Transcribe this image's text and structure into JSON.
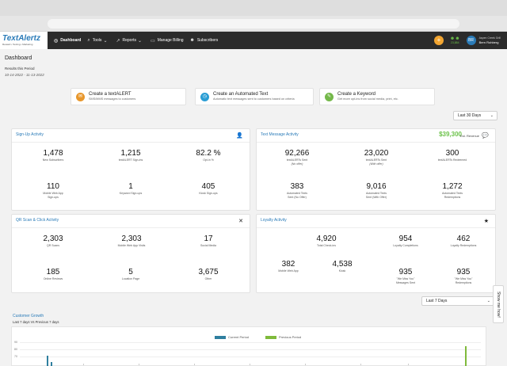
{
  "nav": {
    "logo_text": "TextAlertz",
    "logo_sub": "Reward • Texting • Marketing",
    "items": [
      {
        "label": "Dashboard",
        "icon": "dashboard-icon"
      },
      {
        "label": "Tools",
        "icon": "search-icon"
      },
      {
        "label": "Reports",
        "icon": "chart-icon"
      },
      {
        "label": "Manage Billing",
        "icon": "billing-icon"
      },
      {
        "label": "Subscribers",
        "icon": "subscribers-icon"
      }
    ],
    "plus": "+",
    "subscriber_count": "23,884",
    "avatar": "BR",
    "account_location": "Aspen Creek Grill",
    "account_name": "Bern Rohberg"
  },
  "page": {
    "title": "Dashboard",
    "results_label": "Results this Period",
    "date_range": "10-14-2022 - 11-13-2022"
  },
  "quick_actions": [
    {
      "title": "Create a textALERT",
      "desc": "SMS/MMS messages to customers",
      "color": "#e8972c"
    },
    {
      "title": "Create an Automated Text",
      "desc": "Automatic text messages sent to customers based on criteria",
      "color": "#2a9dd4"
    },
    {
      "title": "Create a Keyword",
      "desc": "Get more opt-ins from social media, print, etc.",
      "color": "#74b84a"
    }
  ],
  "period_select": "Last 30 Days",
  "signup": {
    "title": "Sign-Up Activity",
    "stats": [
      {
        "value": "1,478",
        "label": "New Subscribers",
        "label2": ""
      },
      {
        "value": "1,215",
        "label": "textALERT Sign-ins",
        "label2": ""
      },
      {
        "value": "82.2 %",
        "label": "Opt-in %",
        "label2": ""
      },
      {
        "value": "110",
        "label": "Mobile Web App",
        "label2": "Sign-ups"
      },
      {
        "value": "1",
        "label": "Keyword Sign-ups",
        "label2": ""
      },
      {
        "value": "405",
        "label": "Kiosk Sign-ups",
        "label2": ""
      }
    ]
  },
  "text_message": {
    "title": "Text Message Activity",
    "revenue": "$39,300",
    "revenue_label": "Est. Revenue",
    "stats": [
      {
        "value": "92,266",
        "label": "textALERTs Sent",
        "label2": "(No offer)"
      },
      {
        "value": "23,020",
        "label": "textALERTs Sent",
        "label2": "(With offer)"
      },
      {
        "value": "300",
        "label": "textALERTs Redeemed",
        "label2": ""
      },
      {
        "value": "383",
        "label": "Automated Texts",
        "label2": "Sent (No Offer)"
      },
      {
        "value": "9,016",
        "label": "Automated Texts",
        "label2": "Sent (With Offer)"
      },
      {
        "value": "1,272",
        "label": "Automated Texts",
        "label2": "Redemptions"
      }
    ]
  },
  "qr": {
    "title": "QR Scan & Click Activity",
    "stats": [
      {
        "value": "2,303",
        "label": "QR Scans",
        "label2": ""
      },
      {
        "value": "2,303",
        "label": "Mobile Web App Visits",
        "label2": ""
      },
      {
        "value": "17",
        "label": "Social Media",
        "label2": ""
      },
      {
        "value": "185",
        "label": "Online Reviews",
        "label2": ""
      },
      {
        "value": "5",
        "label": "Location Page",
        "label2": ""
      },
      {
        "value": "3,675",
        "label": "Other",
        "label2": ""
      }
    ]
  },
  "loyalty": {
    "title": "Loyalty Activity",
    "stats": [
      {
        "value": "4,920",
        "label": "Total Check-ins",
        "label2": ""
      },
      {
        "value": "954",
        "label": "Loyalty Completions",
        "label2": ""
      },
      {
        "value": "462",
        "label": "Loyalty Redemptions",
        "label2": ""
      },
      {
        "value": "382",
        "label": "Mobile Web App",
        "label2": ""
      },
      {
        "value": "4,538",
        "label": "Kiosk",
        "label2": ""
      },
      {
        "value": "935",
        "label": "\"We Miss You\"",
        "label2": "Messages Sent"
      },
      {
        "value": "935",
        "label": "\"We Miss You\"",
        "label2": "Redemptions"
      }
    ]
  },
  "growth_select": "Last 7 Days",
  "growth": {
    "title": "Customer Growth",
    "subtitle": "Last 7 days Vs Previous 7 days",
    "legend": [
      "Current Period",
      "Previous Period"
    ],
    "y_ticks": [
      "90",
      "80",
      "70"
    ]
  },
  "show_me_how": "Show me how!",
  "chart_data": {
    "type": "bar",
    "series": [
      {
        "name": "Current Period",
        "color": "#2f7f9f"
      },
      {
        "name": "Previous Period",
        "color": "#7fba3b"
      }
    ],
    "ylim": [
      0,
      90
    ]
  }
}
